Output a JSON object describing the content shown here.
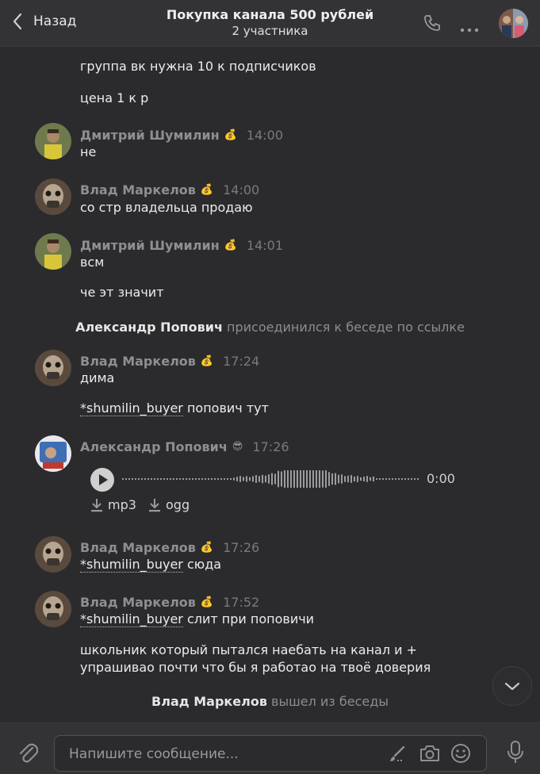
{
  "header": {
    "back_label": "Назад",
    "title": "Покупка канала 500 рублей",
    "subtitle": "2 участника"
  },
  "messages": [
    {
      "text": "группа вк нужна 10 к подписчиков"
    },
    {
      "text": "цена 1 к р"
    },
    {
      "author": "Дмитрий Шумилин",
      "badge": "💰",
      "time": "14:00",
      "text": "не"
    },
    {
      "author": "Влад Маркелов",
      "badge": "💰",
      "time": "14:00",
      "text": "со стр владельца продаю"
    },
    {
      "author": "Дмитрий Шумилин",
      "badge": "💰",
      "time": "14:01",
      "text": "всм"
    },
    {
      "text": "че эт значит"
    },
    {
      "service_name": "Александр Попович",
      "service_text": "присоединился к беседе по ссылке"
    },
    {
      "author": "Влад Маркелов",
      "badge": "💰",
      "time": "17:24",
      "text": "дима"
    },
    {
      "mention": "*shumilin_buyer",
      "text": " попович тут"
    },
    {
      "author": "Александр Попович",
      "badge": "😎",
      "time": "17:26",
      "voice_duration": "0:00",
      "download_mp3": "mp3",
      "download_ogg": "ogg"
    },
    {
      "author": "Влад Маркелов",
      "badge": "💰",
      "time": "17:26",
      "mention": "*shumilin_buyer",
      "text": " сюда"
    },
    {
      "author": "Влад Маркелов",
      "badge": "💰",
      "time": "17:52",
      "mention": "*shumilin_buyer",
      "text": " слит при поповичи"
    },
    {
      "text_line1": "школьник который пытался наебать на канал и +",
      "text_line2": "упрашиваo почти что бы я работао на твоё доверия"
    },
    {
      "service_name": "Влад Маркелов",
      "service_text": "вышел из беседы"
    }
  ],
  "composer": {
    "placeholder": "Напишите сообщение..."
  },
  "colors": {
    "background": "#2b2b2d",
    "header": "#333336",
    "author": "#8f8f93",
    "text": "#ececec"
  }
}
